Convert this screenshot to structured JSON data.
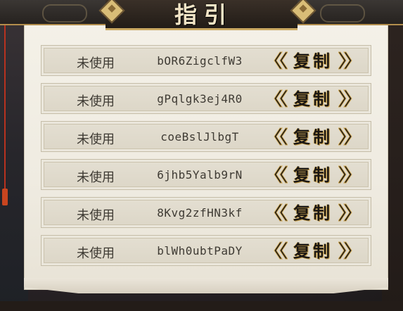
{
  "header": {
    "title": "指引"
  },
  "codes_list": {
    "items": [
      {
        "status": "未使用",
        "code": "bOR6ZigclfW3",
        "copy_label": "复制"
      },
      {
        "status": "未使用",
        "code": "gPqlgk3ej4R0",
        "copy_label": "复制"
      },
      {
        "status": "未使用",
        "code": "coeBslJlbgT",
        "copy_label": "复制"
      },
      {
        "status": "未使用",
        "code": "6jhb5Yalb9rN",
        "copy_label": "复制"
      },
      {
        "status": "未使用",
        "code": "8Kvg2zfHN3kf",
        "copy_label": "复制"
      },
      {
        "status": "未使用",
        "code": "blWh0ubtPaDY",
        "copy_label": "复制"
      }
    ]
  },
  "colors": {
    "paper": "#f0ece2",
    "row_bg": "#dfd9cb",
    "text": "#3e3a33",
    "accent_gold": "#c9a862",
    "frame_dark": "#26221f"
  },
  "icons": {
    "chevron_left": "chevron-left-icon",
    "chevron_right": "chevron-right-icon",
    "ornament": "diamond-gem-icon"
  }
}
